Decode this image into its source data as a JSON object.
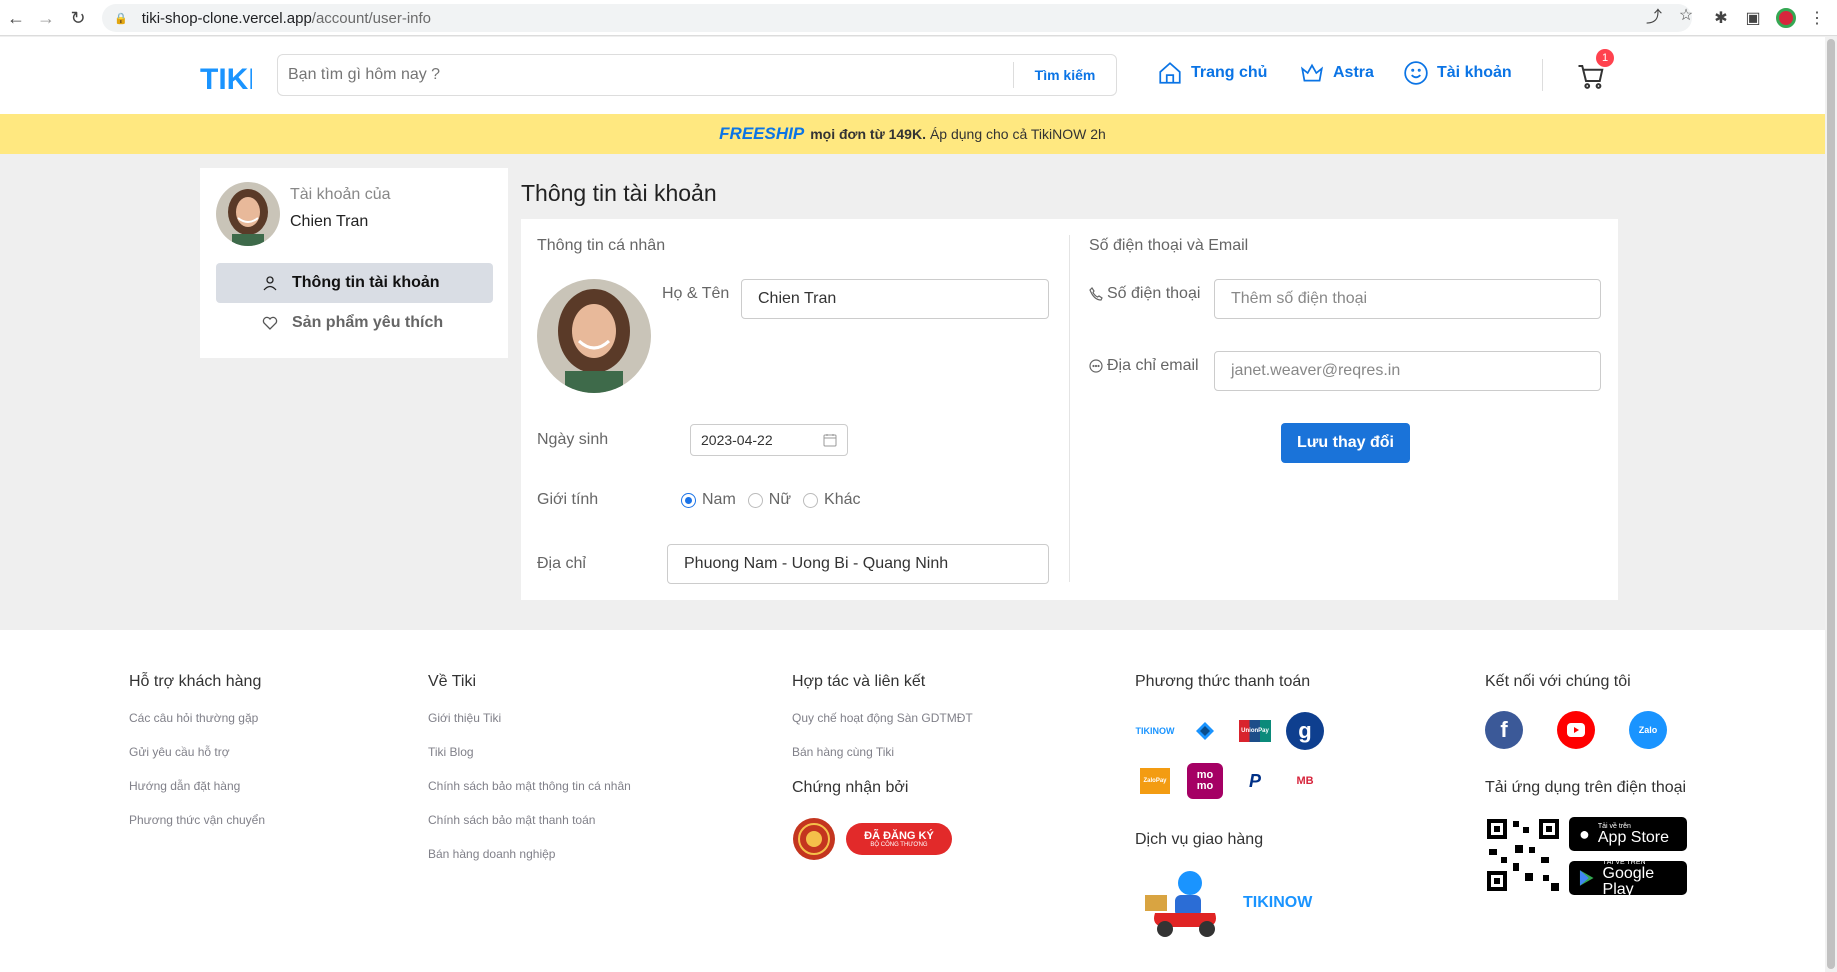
{
  "browser": {
    "url_host": "tiki-shop-clone.vercel.app",
    "url_path": "/account/user-info"
  },
  "header": {
    "logo_text": "TIKI",
    "search_placeholder": "Bạn tìm gì hôm nay ?",
    "search_button": "Tìm kiếm",
    "nav": {
      "home": "Trang chủ",
      "astra": "Astra",
      "account": "Tài khoản"
    },
    "cart_count": "1"
  },
  "promo": {
    "freeship": "FREESHIP",
    "bold_text": "mọi đơn từ 149K.",
    "rest_text": "Áp dụng cho cả TikiNOW 2h"
  },
  "sidebar": {
    "account_of": "Tài khoản của",
    "user_name": "Chien Tran",
    "items": [
      {
        "label": "Thông tin tài khoản",
        "active": true
      },
      {
        "label": "Sản phẩm yêu thích",
        "active": false
      }
    ]
  },
  "main": {
    "title": "Thông tin tài khoản",
    "personal": {
      "section_title": "Thông tin cá nhân",
      "name_label": "Họ & Tên",
      "name_value": "Chien Tran",
      "dob_label": "Ngày sinh",
      "dob_value": "2023-04-22",
      "gender_label": "Giới tính",
      "gender_options": [
        "Nam",
        "Nữ",
        "Khác"
      ],
      "gender_selected": "Nam",
      "address_label": "Địa chỉ",
      "address_value": "Phuong Nam - Uong Bi - Quang Ninh"
    },
    "contact": {
      "section_title": "Số điện thoại và Email",
      "phone_label": "Số điện thoại",
      "phone_placeholder": "Thêm số điện thoại",
      "email_label": "Địa chỉ email",
      "email_value": "janet.weaver@reqres.in",
      "save_button": "Lưu thay đổi"
    }
  },
  "footer": {
    "support": {
      "title": "Hỗ trợ khách hàng",
      "links": [
        "Các câu hỏi thường gặp",
        "Gửi yêu cầu hỗ trợ",
        "Hướng dẫn đặt hàng",
        "Phương thức vận chuyển"
      ]
    },
    "about": {
      "title": "Về Tiki",
      "links": [
        "Giới thiệu Tiki",
        "Tiki Blog",
        "Chính sách bảo mật thông tin cá nhân",
        "Chính sách bảo mật thanh toán",
        "Bán hàng doanh nghiệp"
      ]
    },
    "partner": {
      "title": "Hợp tác và liên kết",
      "links": [
        "Quy chế hoạt động Sàn GDTMĐT",
        "Bán hàng cùng Tiki"
      ],
      "cert_title": "Chứng nhận bởi",
      "cert_badge_text": "ĐÃ ĐĂNG KÝ",
      "cert_badge_sub": "BỘ CÔNG THƯƠNG"
    },
    "payment": {
      "title": "Phương thức thanh toán",
      "methods": [
        "TIKINOW",
        "",
        "UnionPay",
        "g",
        "ZaloPay",
        "mo mo",
        "P",
        "MB"
      ],
      "delivery_title": "Dịch vụ giao hàng",
      "delivery_brand": "TIKINOW"
    },
    "connect": {
      "title": "Kết nối với chúng tôi",
      "app_title": "Tải ứng dụng trên điện thoại",
      "appstore_small": "Tải về trên",
      "appstore_big": "App Store",
      "googleplay_small": "TẢI VỀ TRÊN",
      "googleplay_big": "Google Play"
    }
  }
}
